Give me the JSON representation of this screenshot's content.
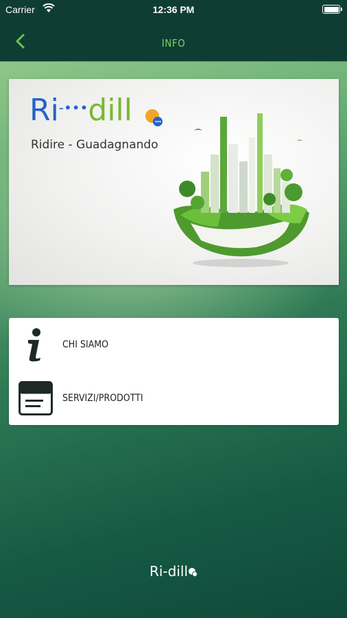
{
  "status": {
    "carrier": "Carrier",
    "time": "12:36 PM"
  },
  "nav": {
    "title": "INFO"
  },
  "banner": {
    "logo": {
      "part1": "Ri",
      "dots": "-•••",
      "part2": "dill"
    },
    "tagline": "Ridire - Guadagnando"
  },
  "menu": {
    "items": [
      {
        "label": "CHI SIAMO",
        "icon": "info-icon"
      },
      {
        "label": "SERVIZI/PRODOTTI",
        "icon": "card-list-icon"
      }
    ]
  },
  "footer": {
    "logo": "Ri-dill"
  },
  "colors": {
    "header": "#0f3d34",
    "accent": "#7fcf6a",
    "brand_blue": "#2563c9",
    "brand_green": "#7ab830"
  }
}
